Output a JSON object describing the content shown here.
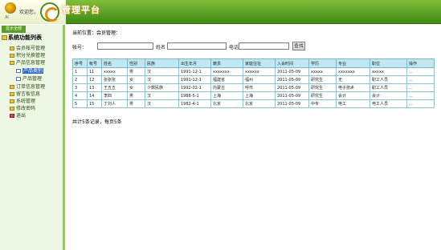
{
  "header": {
    "welcome": "欢迎您，",
    "app_title": "管理平台",
    "logo_caption": "Al"
  },
  "sidebar": {
    "top_button": "显示全部",
    "root_label": "系统功能列表",
    "items": [
      {
        "label": "会员帐号管理",
        "level": 1,
        "icon": "folder-icon"
      },
      {
        "label": "积分兑换管理",
        "level": 1,
        "icon": "folder-icon"
      },
      {
        "label": "产品信息管理",
        "level": 1,
        "icon": "folder-open-icon"
      },
      {
        "label": "产品类别",
        "level": 2,
        "icon": "document-icon",
        "selected": true
      },
      {
        "label": "产品管理",
        "level": 2,
        "icon": "document-icon"
      },
      {
        "label": "订单信息管理",
        "level": 1,
        "icon": "folder-icon"
      },
      {
        "label": "留言板信息",
        "level": 1,
        "icon": "folder-icon"
      },
      {
        "label": "系统管理",
        "level": 1,
        "icon": "folder-icon"
      },
      {
        "label": "修改密码",
        "level": 1,
        "icon": "key-icon"
      },
      {
        "label": "退出",
        "level": 1,
        "icon": "exit-icon"
      }
    ]
  },
  "main": {
    "breadcrumb": "当前位置：会员管理：",
    "search": {
      "label_account": "帐号：",
      "label_name": "姓名",
      "label_phone": "电话",
      "button": "查找",
      "account_value": "",
      "name_value": "",
      "phone_value": ""
    },
    "table": {
      "columns": [
        "序号",
        "帐号",
        "姓名",
        "性别",
        "民族",
        "出生年月",
        "籍贯",
        "家庭住址",
        "入会时间",
        "学历",
        "专业",
        "职位",
        "操作"
      ],
      "rows": [
        [
          "1",
          "11",
          "xxxxx",
          "男",
          "汉",
          "1991-12-1",
          "xxxxxxx",
          "xxxxxx",
          "2011-05-09",
          "xxxxx",
          "xxxxxxx",
          "xxxxx",
          "..."
        ],
        [
          "2",
          "12",
          "张张张",
          "女",
          "汉",
          "1991-12-1",
          "福建省",
          "福州",
          "2011-05-09",
          "研究生",
          "无",
          "职工人员",
          "..."
        ],
        [
          "3",
          "13",
          "王五五",
          "女",
          "少数民族",
          "1992-02-1",
          "内蒙古",
          "呼市",
          "2011-05-09",
          "研究生",
          "电子技术",
          "职工人员",
          "..."
        ],
        [
          "4",
          "14",
          "李四",
          "男",
          "汉",
          "1988-5-1",
          "上海",
          "上海",
          "2011-05-09",
          "研究生",
          "会计",
          "会计",
          "..."
        ],
        [
          "5",
          "15",
          "丁刘人",
          "男",
          "汉",
          "1982-4-1",
          "北京",
          "北京",
          "2011-05-09",
          "中专",
          "电工",
          "电工人员",
          "..."
        ]
      ]
    },
    "summary": "共计5条记录，每页5条"
  },
  "colors": {
    "header_green": "#3f8a14",
    "sidebar_bg": "#eef6e4",
    "table_header": "#bfe8f2",
    "table_border": "#8fc3d3",
    "title_glow": "#e89a20"
  }
}
